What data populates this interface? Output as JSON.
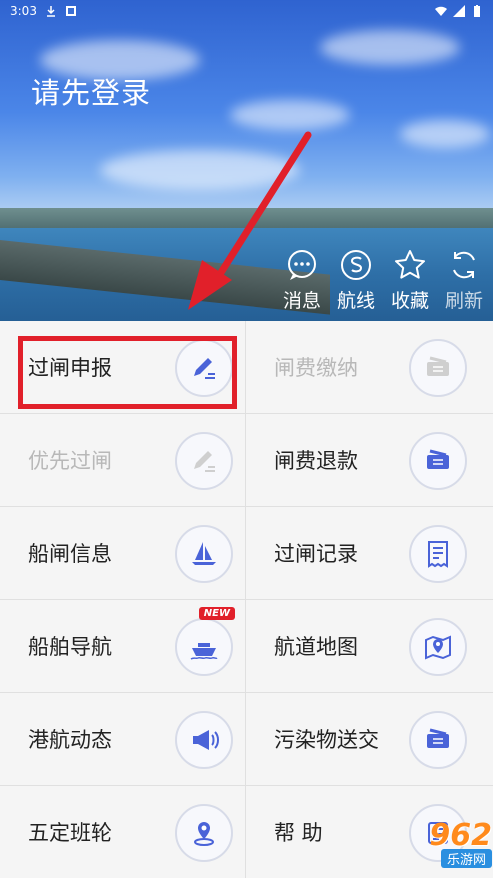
{
  "status_bar": {
    "time": "3:03"
  },
  "hero": {
    "login_text": "请先登录",
    "actions": [
      {
        "label": "消息",
        "icon": "message-icon"
      },
      {
        "label": "航线",
        "icon": "route-icon"
      },
      {
        "label": "收藏",
        "icon": "star-icon"
      },
      {
        "label": "刷新",
        "icon": "refresh-icon"
      }
    ]
  },
  "menu": {
    "items": [
      {
        "label": "过闸申报",
        "icon": "edit-icon",
        "enabled": true
      },
      {
        "label": "闸费缴纳",
        "icon": "ticket-icon",
        "enabled": false
      },
      {
        "label": "优先过闸",
        "icon": "edit-icon",
        "enabled": false
      },
      {
        "label": "闸费退款",
        "icon": "ticket-icon",
        "enabled": true
      },
      {
        "label": "船闸信息",
        "icon": "sailboat-icon",
        "enabled": true
      },
      {
        "label": "过闸记录",
        "icon": "receipt-icon",
        "enabled": true
      },
      {
        "label": "船舶导航",
        "icon": "ship-icon",
        "enabled": true,
        "badge": "NEW"
      },
      {
        "label": "航道地图",
        "icon": "map-icon",
        "enabled": true
      },
      {
        "label": "港航动态",
        "icon": "megaphone-icon",
        "enabled": true
      },
      {
        "label": "污染物送交",
        "icon": "ticket-icon",
        "enabled": true
      },
      {
        "label": "五定班轮",
        "icon": "location-icon",
        "enabled": true
      },
      {
        "label": "帮 助",
        "icon": "help-icon",
        "enabled": true
      }
    ]
  },
  "watermark": {
    "logo": "962",
    "sub": "乐游网"
  },
  "colors": {
    "accent": "#4a63d8",
    "highlight": "#e1202a",
    "disabled": "#b8b8b8"
  }
}
